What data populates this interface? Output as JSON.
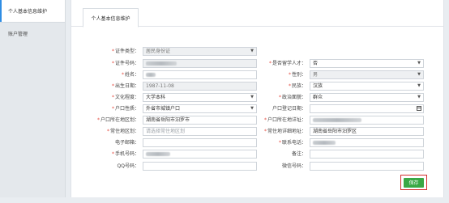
{
  "sidebar": {
    "items": [
      {
        "label": "个人基本信息维护",
        "active": true
      },
      {
        "label": "账户管理",
        "active": false
      }
    ]
  },
  "tabs": [
    {
      "label": "个人基本信息维护"
    }
  ],
  "form": {
    "left": [
      {
        "label": "证件类型：",
        "required": true,
        "value": "居民身份证",
        "kind": "select-disabled"
      },
      {
        "label": "证件号码：",
        "required": true,
        "value": "",
        "kind": "blurred-disabled"
      },
      {
        "label": "姓名：",
        "required": true,
        "value": "",
        "kind": "blurred"
      },
      {
        "label": "出生日期：",
        "required": true,
        "value": "1987-11-08",
        "kind": "disabled"
      },
      {
        "label": "文化程度：",
        "required": true,
        "value": "大学本科",
        "kind": "select"
      },
      {
        "label": "户口性质：",
        "required": true,
        "value": "外省市城镇户口",
        "kind": "select"
      },
      {
        "label": "户口所在地区划：",
        "required": true,
        "value": "湖南省岳阳市汨罗市",
        "kind": "input"
      },
      {
        "label": "常住地区划：",
        "required": true,
        "placeholder": "请选择常住地区划",
        "kind": "placeholder"
      },
      {
        "label": "电子邮箱：",
        "required": false,
        "value": "",
        "kind": "input"
      },
      {
        "label": "手机号码：",
        "required": true,
        "value": "",
        "kind": "blurred"
      },
      {
        "label": "QQ号码：",
        "required": false,
        "value": "",
        "kind": "input"
      }
    ],
    "right": [
      {
        "label": "是否留学人才：",
        "required": true,
        "value": "否",
        "kind": "select"
      },
      {
        "label": "性别：",
        "required": true,
        "value": "男",
        "kind": "select-disabled"
      },
      {
        "label": "民族：",
        "required": true,
        "value": "汉族",
        "kind": "select"
      },
      {
        "label": "政治面貌：",
        "required": true,
        "value": "群众",
        "kind": "select"
      },
      {
        "label": "户口登记日期：",
        "required": false,
        "value": "",
        "kind": "date"
      },
      {
        "label": "户口所在地详址：",
        "required": true,
        "value": "",
        "kind": "blurred"
      },
      {
        "label": "常住地详细地址：",
        "required": true,
        "value": "湖南省岳阳市汨罗区",
        "kind": "input"
      },
      {
        "label": "联系电话：",
        "required": true,
        "value": "",
        "kind": "blurred"
      },
      {
        "label": "备注：",
        "required": false,
        "value": "",
        "kind": "input"
      },
      {
        "label": "微信号码：",
        "required": false,
        "value": "",
        "kind": "input"
      }
    ]
  },
  "actions": {
    "save_label": "保存"
  },
  "colors": {
    "accent": "#2f8de4",
    "required": "#e54d42",
    "save": "#3aa845",
    "highlight": "#d32f2f"
  }
}
